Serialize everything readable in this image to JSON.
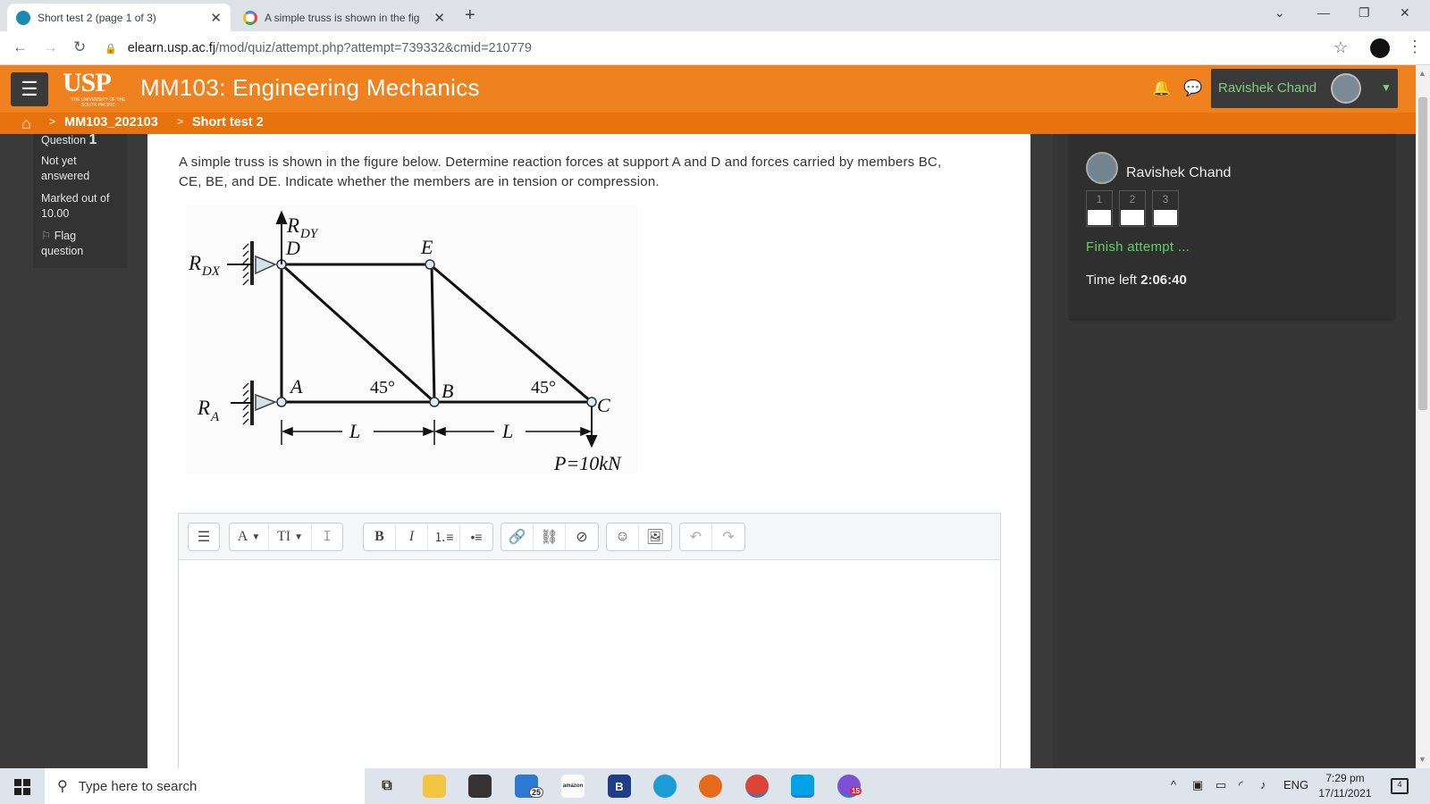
{
  "browser": {
    "tabs": [
      {
        "title": "Short test 2 (page 1 of 3)",
        "active": true,
        "favicon": "moodle-favicon"
      },
      {
        "title": "A simple truss is shown in the fig",
        "active": false,
        "favicon": "google-favicon"
      }
    ],
    "url_host": "elearn.usp.ac.fj",
    "url_path": "/mod/quiz/attempt.php?attempt=739332&cmid=210779"
  },
  "site": {
    "logo_text": "USP",
    "logo_subtitle": "THE UNIVERSITY OF THE SOUTH PACIFIC",
    "course_title": "MM103: Engineering Mechanics",
    "user_name": "Ravishek Chand",
    "colors": {
      "header": "#f0811f",
      "breadcrumb": "#e8720e",
      "accent_green": "#5dd35d"
    }
  },
  "breadcrumb": [
    "MM103_202103",
    "Short test 2"
  ],
  "question_info": {
    "label": "Question",
    "number": "1",
    "status": "Not yet answered",
    "marks": "Marked out of 10.00",
    "flag": "Flag question"
  },
  "question": {
    "text": "A simple truss is shown in the figure below. Determine reaction forces at support A and D and forces carried by members BC, CE, BE, and DE. Indicate whether the members are in tension or compression.",
    "figure": {
      "node_labels": [
        "D",
        "E",
        "A",
        "B",
        "C"
      ],
      "angle_labels": [
        "45°",
        "45°"
      ],
      "dimension_labels": [
        "L",
        "L"
      ],
      "load_label": "P=10kN",
      "reaction_rdy": "DY",
      "reaction_rdx": "DX",
      "reaction_ra": "A",
      "reaction_symbol": "R"
    }
  },
  "editor": {
    "toolbar_icons": [
      "menu-icon",
      "font-color-icon",
      "font-size-icon",
      "text-cursor-icon",
      "bold-icon",
      "italic-icon",
      "ordered-list-icon",
      "unordered-list-icon",
      "link-icon",
      "unlink-icon",
      "no-autolink-icon",
      "emoji-icon",
      "image-icon",
      "undo-icon",
      "redo-icon"
    ],
    "labels": {
      "font": "A",
      "size": "TI",
      "bold": "B",
      "italic": "I"
    }
  },
  "quiz_nav": {
    "user_name": "Ravishek Chand",
    "question_numbers": [
      "1",
      "2",
      "3"
    ],
    "finish_label": "Finish attempt ...",
    "time_left_label": "Time left",
    "time_left_value": "2:06:40"
  },
  "taskbar": {
    "search_placeholder": "Type here to search",
    "mail_badge": "25",
    "amazon_label": "amazon",
    "b_label": "B",
    "viber_badge": "15",
    "lang": "ENG",
    "time": "7:29 pm",
    "date": "17/11/2021",
    "notif_count": "4"
  }
}
